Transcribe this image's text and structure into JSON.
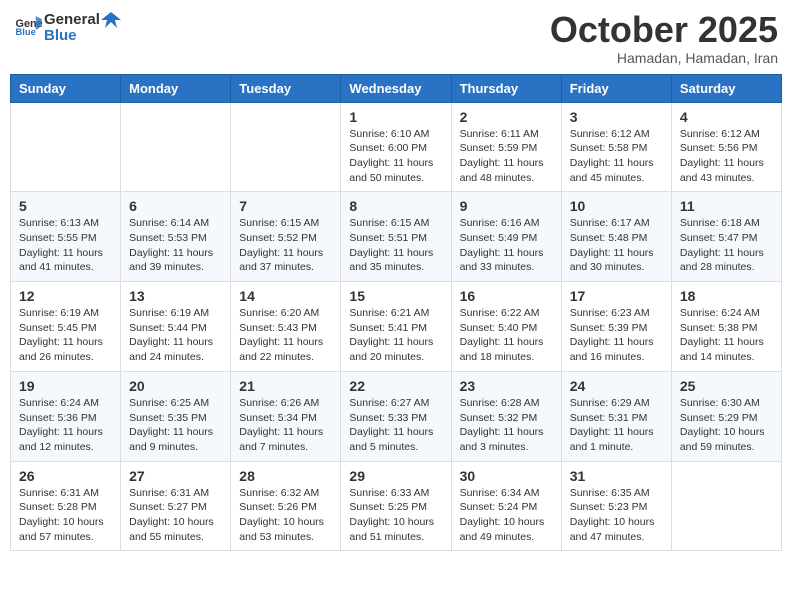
{
  "header": {
    "logo": {
      "general": "General",
      "blue": "Blue"
    },
    "title": "October 2025",
    "location": "Hamadan, Hamadan, Iran"
  },
  "weekdays": [
    "Sunday",
    "Monday",
    "Tuesday",
    "Wednesday",
    "Thursday",
    "Friday",
    "Saturday"
  ],
  "weeks": [
    [
      {
        "day": "",
        "info": ""
      },
      {
        "day": "",
        "info": ""
      },
      {
        "day": "",
        "info": ""
      },
      {
        "day": "1",
        "info": "Sunrise: 6:10 AM\nSunset: 6:00 PM\nDaylight: 11 hours\nand 50 minutes."
      },
      {
        "day": "2",
        "info": "Sunrise: 6:11 AM\nSunset: 5:59 PM\nDaylight: 11 hours\nand 48 minutes."
      },
      {
        "day": "3",
        "info": "Sunrise: 6:12 AM\nSunset: 5:58 PM\nDaylight: 11 hours\nand 45 minutes."
      },
      {
        "day": "4",
        "info": "Sunrise: 6:12 AM\nSunset: 5:56 PM\nDaylight: 11 hours\nand 43 minutes."
      }
    ],
    [
      {
        "day": "5",
        "info": "Sunrise: 6:13 AM\nSunset: 5:55 PM\nDaylight: 11 hours\nand 41 minutes."
      },
      {
        "day": "6",
        "info": "Sunrise: 6:14 AM\nSunset: 5:53 PM\nDaylight: 11 hours\nand 39 minutes."
      },
      {
        "day": "7",
        "info": "Sunrise: 6:15 AM\nSunset: 5:52 PM\nDaylight: 11 hours\nand 37 minutes."
      },
      {
        "day": "8",
        "info": "Sunrise: 6:15 AM\nSunset: 5:51 PM\nDaylight: 11 hours\nand 35 minutes."
      },
      {
        "day": "9",
        "info": "Sunrise: 6:16 AM\nSunset: 5:49 PM\nDaylight: 11 hours\nand 33 minutes."
      },
      {
        "day": "10",
        "info": "Sunrise: 6:17 AM\nSunset: 5:48 PM\nDaylight: 11 hours\nand 30 minutes."
      },
      {
        "day": "11",
        "info": "Sunrise: 6:18 AM\nSunset: 5:47 PM\nDaylight: 11 hours\nand 28 minutes."
      }
    ],
    [
      {
        "day": "12",
        "info": "Sunrise: 6:19 AM\nSunset: 5:45 PM\nDaylight: 11 hours\nand 26 minutes."
      },
      {
        "day": "13",
        "info": "Sunrise: 6:19 AM\nSunset: 5:44 PM\nDaylight: 11 hours\nand 24 minutes."
      },
      {
        "day": "14",
        "info": "Sunrise: 6:20 AM\nSunset: 5:43 PM\nDaylight: 11 hours\nand 22 minutes."
      },
      {
        "day": "15",
        "info": "Sunrise: 6:21 AM\nSunset: 5:41 PM\nDaylight: 11 hours\nand 20 minutes."
      },
      {
        "day": "16",
        "info": "Sunrise: 6:22 AM\nSunset: 5:40 PM\nDaylight: 11 hours\nand 18 minutes."
      },
      {
        "day": "17",
        "info": "Sunrise: 6:23 AM\nSunset: 5:39 PM\nDaylight: 11 hours\nand 16 minutes."
      },
      {
        "day": "18",
        "info": "Sunrise: 6:24 AM\nSunset: 5:38 PM\nDaylight: 11 hours\nand 14 minutes."
      }
    ],
    [
      {
        "day": "19",
        "info": "Sunrise: 6:24 AM\nSunset: 5:36 PM\nDaylight: 11 hours\nand 12 minutes."
      },
      {
        "day": "20",
        "info": "Sunrise: 6:25 AM\nSunset: 5:35 PM\nDaylight: 11 hours\nand 9 minutes."
      },
      {
        "day": "21",
        "info": "Sunrise: 6:26 AM\nSunset: 5:34 PM\nDaylight: 11 hours\nand 7 minutes."
      },
      {
        "day": "22",
        "info": "Sunrise: 6:27 AM\nSunset: 5:33 PM\nDaylight: 11 hours\nand 5 minutes."
      },
      {
        "day": "23",
        "info": "Sunrise: 6:28 AM\nSunset: 5:32 PM\nDaylight: 11 hours\nand 3 minutes."
      },
      {
        "day": "24",
        "info": "Sunrise: 6:29 AM\nSunset: 5:31 PM\nDaylight: 11 hours\nand 1 minute."
      },
      {
        "day": "25",
        "info": "Sunrise: 6:30 AM\nSunset: 5:29 PM\nDaylight: 10 hours\nand 59 minutes."
      }
    ],
    [
      {
        "day": "26",
        "info": "Sunrise: 6:31 AM\nSunset: 5:28 PM\nDaylight: 10 hours\nand 57 minutes."
      },
      {
        "day": "27",
        "info": "Sunrise: 6:31 AM\nSunset: 5:27 PM\nDaylight: 10 hours\nand 55 minutes."
      },
      {
        "day": "28",
        "info": "Sunrise: 6:32 AM\nSunset: 5:26 PM\nDaylight: 10 hours\nand 53 minutes."
      },
      {
        "day": "29",
        "info": "Sunrise: 6:33 AM\nSunset: 5:25 PM\nDaylight: 10 hours\nand 51 minutes."
      },
      {
        "day": "30",
        "info": "Sunrise: 6:34 AM\nSunset: 5:24 PM\nDaylight: 10 hours\nand 49 minutes."
      },
      {
        "day": "31",
        "info": "Sunrise: 6:35 AM\nSunset: 5:23 PM\nDaylight: 10 hours\nand 47 minutes."
      },
      {
        "day": "",
        "info": ""
      }
    ]
  ]
}
